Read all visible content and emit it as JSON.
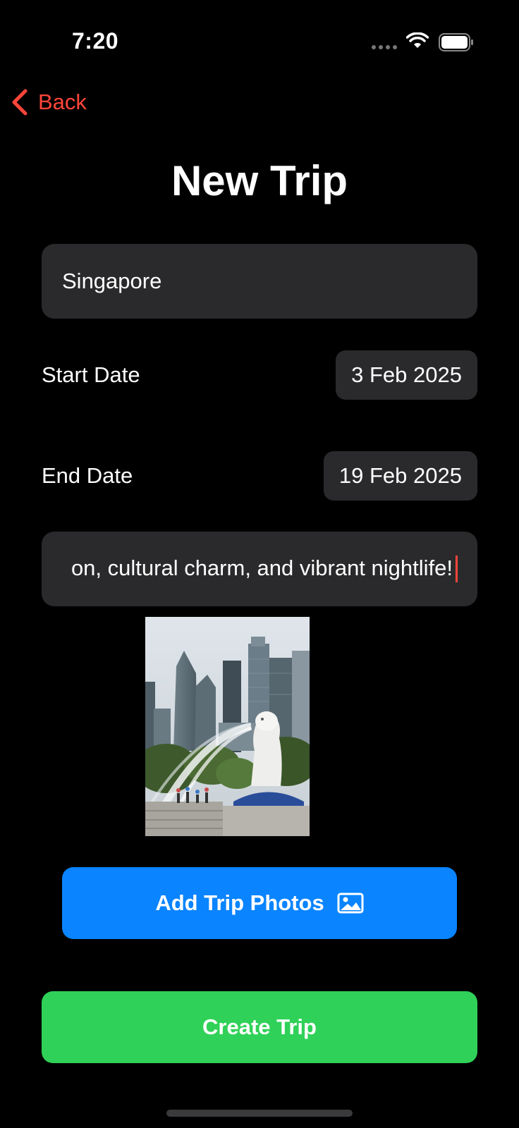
{
  "status_bar": {
    "time": "7:20",
    "icons": [
      "signal-icon",
      "wifi-icon",
      "battery-icon"
    ]
  },
  "nav": {
    "back_label": "Back",
    "back_icon": "chevron-left-icon",
    "accent_color": "#ff453a"
  },
  "page": {
    "title": "New Trip"
  },
  "form": {
    "trip_name": "Singapore",
    "start_date_label": "Start Date",
    "start_date_value": "3 Feb 2025",
    "end_date_label": "End Date",
    "end_date_value": "19 Feb 2025",
    "description": "on, cultural charm, and vibrant nightlife!"
  },
  "photos": {
    "thumbnail": "merlion-photo"
  },
  "buttons": {
    "add_photos_label": "Add Trip Photos",
    "add_photos_icon": "photo-icon",
    "add_photos_color": "#0a84ff",
    "create_trip_label": "Create Trip",
    "create_trip_color": "#30d158"
  }
}
